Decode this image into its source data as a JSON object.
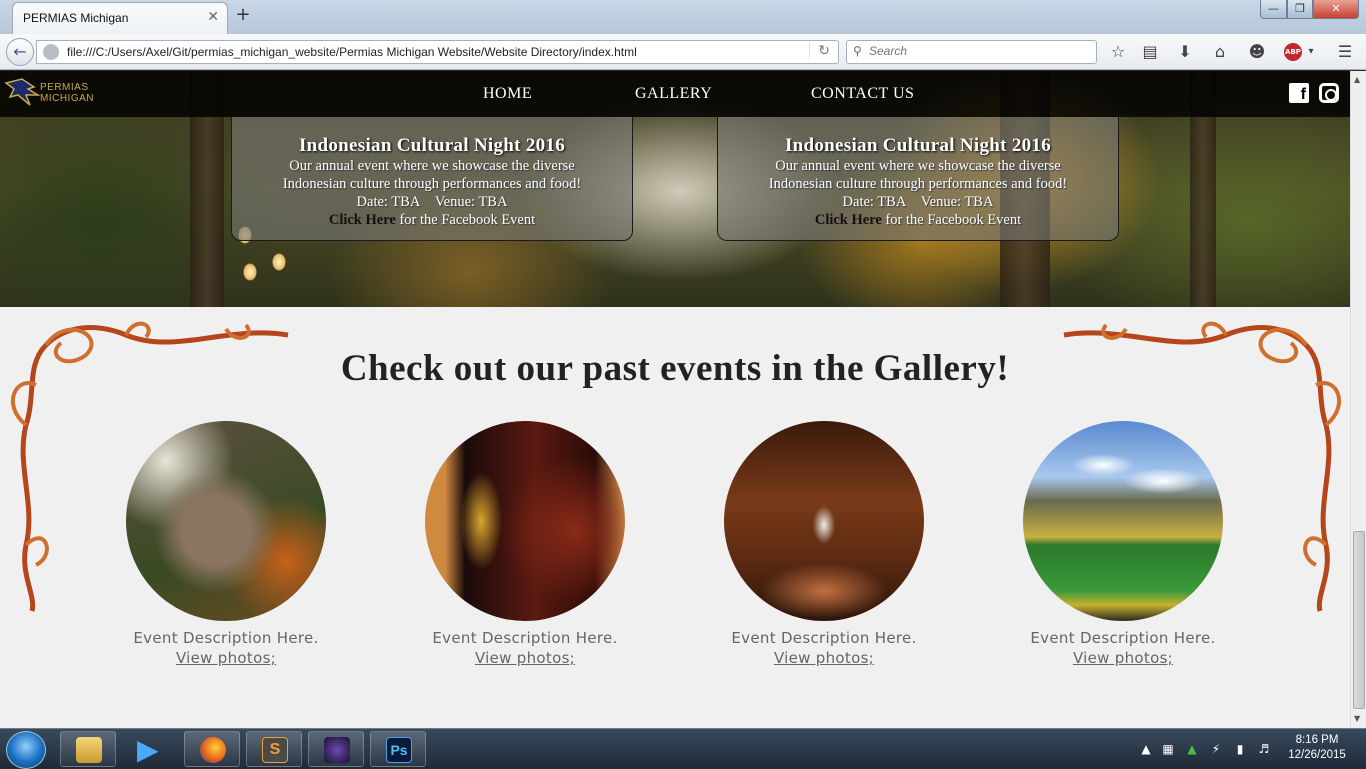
{
  "browser": {
    "tab_title": "PERMIAS Michigan",
    "tab_close": "✕",
    "new_tab": "+",
    "url": "file:///C:/Users/Axel/Git/permias_michigan_website/Permias Michigan Website/Website Directory/index.html",
    "search_placeholder": "Search",
    "abp_label": "ABP"
  },
  "site": {
    "logo_text_line1": "PERMIAS",
    "logo_text_line2": "MICHIGAN",
    "nav": [
      "HOME",
      "GALLERY",
      "CONTACT US"
    ]
  },
  "events": [
    {
      "title": "Indonesian Cultural Night 2016",
      "desc1": "Our annual event where we showcase the diverse",
      "desc2": "Indonesian culture through performances and food!",
      "date_label": "Date: TBA",
      "venue_label": "Venue: TBA",
      "click_here": "Click Here",
      "fb_text": " for the Facebook Event"
    },
    {
      "title": "Indonesian Cultural Night 2016",
      "desc1": "Our annual event where we showcase the diverse",
      "desc2": "Indonesian culture through performances and food!",
      "date_label": "Date: TBA",
      "venue_label": "Venue: TBA",
      "click_here": "Click Here",
      "fb_text": " for the Facebook Event"
    }
  ],
  "gallery": {
    "heading": "Check out our past events in the Gallery!",
    "items": [
      {
        "desc": "Event Description Here.",
        "link": "View photos;",
        "image": "squirrel"
      },
      {
        "desc": "Event Description Here.",
        "link": "View photos;",
        "image": "dancer"
      },
      {
        "desc": "Event Description Here.",
        "link": "View photos;",
        "image": "reading-room"
      },
      {
        "desc": "Event Description Here.",
        "link": "View photos;",
        "image": "stadium"
      }
    ]
  },
  "taskbar": {
    "time": "8:16 PM",
    "date": "12/26/2015",
    "ps_label": "Ps",
    "sublime_label": "S"
  }
}
